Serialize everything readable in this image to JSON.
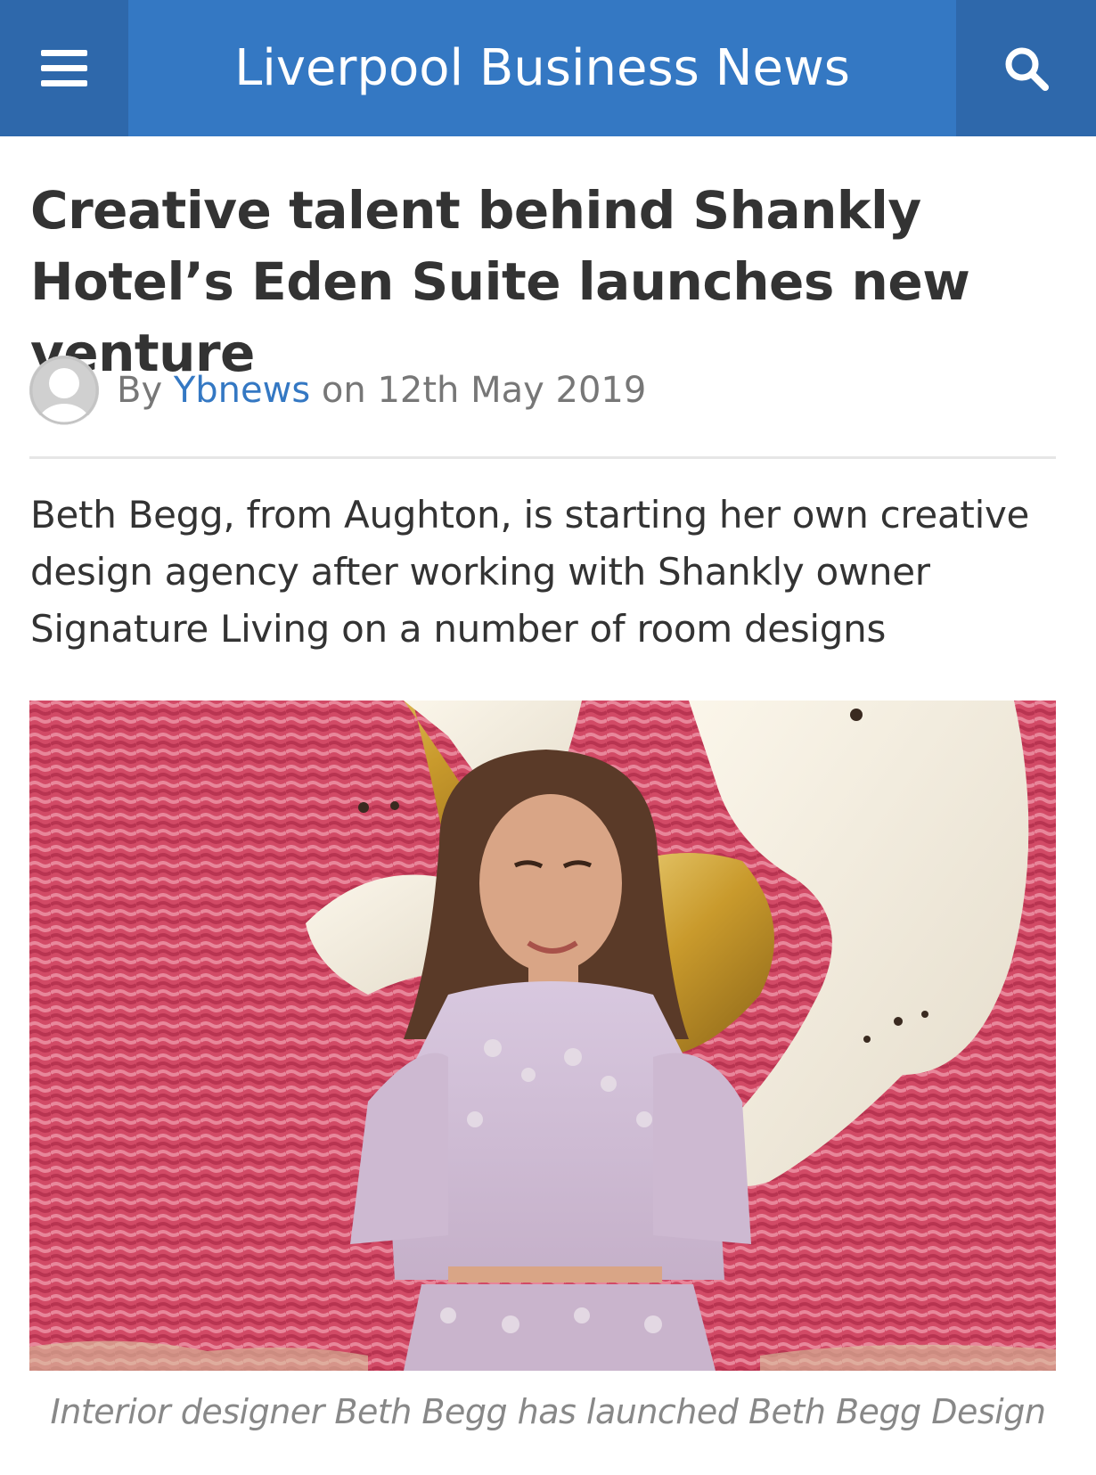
{
  "header": {
    "site_title": "Liverpool Business News",
    "background_color": "#3478c3",
    "button_color": "#2e68ab",
    "menu_icon": "hamburger-menu-icon",
    "search_icon": "search-icon"
  },
  "article": {
    "headline": "Creative talent behind Shankly Hotel’s Eden Suite launches new venture",
    "byline": {
      "by_label": "By",
      "author": "Ybnews",
      "on_label": "on",
      "date": "12th May 2019",
      "author_color": "#3478c3"
    },
    "standfirst": "Beth Begg, from Aughton, is starting her own creative design agency after working with Shankly owner Signature Living on a number of room designs",
    "image": {
      "caption": "Interior designer Beth Begg has launched Beth Begg Design"
    }
  }
}
